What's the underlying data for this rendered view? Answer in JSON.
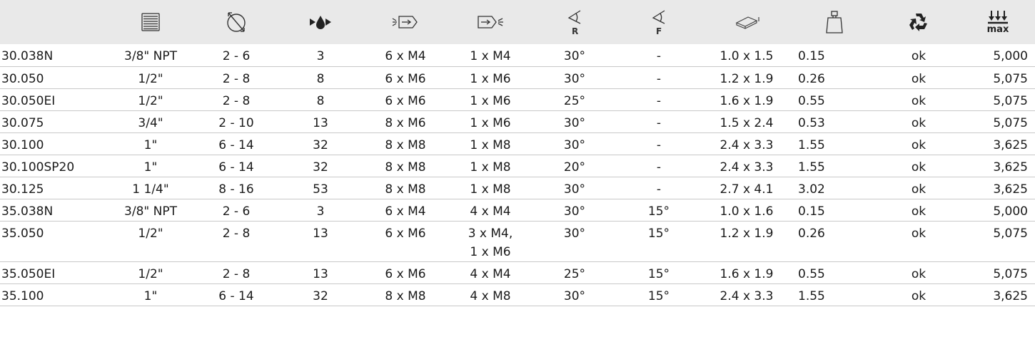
{
  "header": {
    "icons": [
      "",
      "thread-icon",
      "bore-range-icon",
      "flow-icon",
      "inlet-bolts-icon",
      "outlet-bolts-icon",
      "rear-angle-icon",
      "front-angle-icon",
      "dimensions-icon",
      "weight-icon",
      "recycle-icon",
      "max-pressure-icon"
    ],
    "max_label": "max",
    "r_label": "R",
    "f_label": "F"
  },
  "rows": [
    {
      "model": "30.038N",
      "thread": "3/8\" NPT",
      "range": "2 - 6",
      "flow": "3",
      "inlet": "6 x M4",
      "outlet": "1 x M4",
      "angle_r": "30°",
      "angle_f": "-",
      "dims": "1.0 x 1.5",
      "weight": "0.15",
      "recycle": "ok",
      "max": "5,000"
    },
    {
      "model": "30.050",
      "thread": "1/2\"",
      "range": "2 - 8",
      "flow": "8",
      "inlet": "6 x M6",
      "outlet": "1 x M6",
      "angle_r": "30°",
      "angle_f": "-",
      "dims": "1.2 x 1.9",
      "weight": "0.26",
      "recycle": "ok",
      "max": "5,075"
    },
    {
      "model": "30.050EI",
      "thread": "1/2\"",
      "range": "2 - 8",
      "flow": "8",
      "inlet": "6 x M6",
      "outlet": "1 x M6",
      "angle_r": "25°",
      "angle_f": "-",
      "dims": "1.6 x 1.9",
      "weight": "0.55",
      "recycle": "ok",
      "max": "5,075"
    },
    {
      "model": "30.075",
      "thread": "3/4\"",
      "range": "2 - 10",
      "flow": "13",
      "inlet": "8 x M6",
      "outlet": "1 x M6",
      "angle_r": "30°",
      "angle_f": "-",
      "dims": "1.5 x 2.4",
      "weight": "0.53",
      "recycle": "ok",
      "max": "5,075"
    },
    {
      "model": "30.100",
      "thread": "1\"",
      "range": "6 - 14",
      "flow": "32",
      "inlet": "8 x M8",
      "outlet": "1 x M8",
      "angle_r": "30°",
      "angle_f": "-",
      "dims": "2.4 x 3.3",
      "weight": "1.55",
      "recycle": "ok",
      "max": "3,625"
    },
    {
      "model": "30.100SP20",
      "thread": "1\"",
      "range": "6 - 14",
      "flow": "32",
      "inlet": "8 x M8",
      "outlet": "1 x M8",
      "angle_r": "20°",
      "angle_f": "-",
      "dims": "2.4 x 3.3",
      "weight": "1.55",
      "recycle": "ok",
      "max": "3,625"
    },
    {
      "model": "30.125",
      "thread": "1 1/4\"",
      "range": "8 - 16",
      "flow": "53",
      "inlet": "8 x M8",
      "outlet": "1 x M8",
      "angle_r": "30°",
      "angle_f": "-",
      "dims": "2.7 x 4.1",
      "weight": "3.02",
      "recycle": "ok",
      "max": "3,625"
    },
    {
      "model": "35.038N",
      "thread": "3/8\" NPT",
      "range": "2 - 6",
      "flow": "3",
      "inlet": "6 x M4",
      "outlet": "4 x M4",
      "angle_r": "30°",
      "angle_f": "15°",
      "dims": "1.0 x 1.6",
      "weight": "0.15",
      "recycle": "ok",
      "max": "5,000"
    },
    {
      "model": "35.050",
      "thread": "1/2\"",
      "range": "2 - 8",
      "flow": "13",
      "inlet": "6 x M6",
      "outlet": "3 x M4,",
      "outlet2": "1 x M6",
      "angle_r": "30°",
      "angle_f": "15°",
      "dims": "1.2 x 1.9",
      "weight": "0.26",
      "recycle": "ok",
      "max": "5,075"
    },
    {
      "model": "35.050EI",
      "thread": "1/2\"",
      "range": "2 - 8",
      "flow": "13",
      "inlet": "6 x M6",
      "outlet": "4 x M4",
      "angle_r": "25°",
      "angle_f": "15°",
      "dims": "1.6 x 1.9",
      "weight": "0.55",
      "recycle": "ok",
      "max": "5,075"
    },
    {
      "model": "35.100",
      "thread": "1\"",
      "range": "6 - 14",
      "flow": "32",
      "inlet": "8 x M8",
      "outlet": "4 x M8",
      "angle_r": "30°",
      "angle_f": "15°",
      "dims": "2.4 x 3.3",
      "weight": "1.55",
      "recycle": "ok",
      "max": "3,625"
    }
  ]
}
